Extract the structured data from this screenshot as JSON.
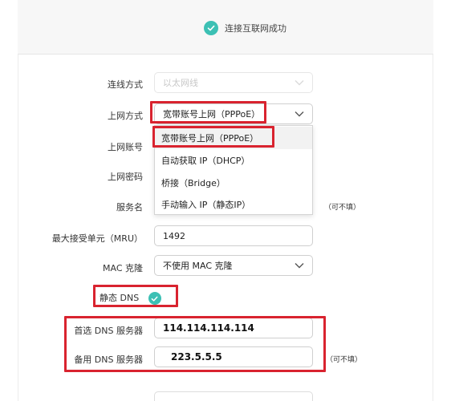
{
  "status": {
    "text": "连接互联网成功",
    "icon": "check-icon",
    "color": "#3cc0b4"
  },
  "form": {
    "connection_type": {
      "label": "连线方式",
      "value": "以太网线",
      "disabled": true
    },
    "internet_mode": {
      "label": "上网方式",
      "value": "宽带账号上网（PPPoE）"
    },
    "account": {
      "label": "上网账号"
    },
    "password": {
      "label": "上网密码"
    },
    "service_name": {
      "label": "服务名",
      "note": "（可不填）"
    },
    "mru": {
      "label": "最大接受单元（MRU）",
      "value": "1492"
    },
    "mac_clone": {
      "label": "MAC 克隆",
      "value": "不使用 MAC 克隆"
    },
    "static_dns": {
      "label": "静态 DNS",
      "checked": true
    },
    "primary_dns": {
      "label": "首选 DNS 服务器",
      "value": "114.114.114.114"
    },
    "secondary_dns": {
      "label": "备用 DNS 服务器",
      "value": "223.5.5.5",
      "note": "（可不填）"
    }
  },
  "dropdown": {
    "options": [
      "宽带账号上网（PPPoE）",
      "自动获取 IP（DHCP）",
      "桥接（Bridge）",
      "手动输入 IP（静态IP）"
    ],
    "selected_index": 0
  },
  "colors": {
    "accent": "#3cc0b4",
    "highlight_box": "#d9232f"
  }
}
